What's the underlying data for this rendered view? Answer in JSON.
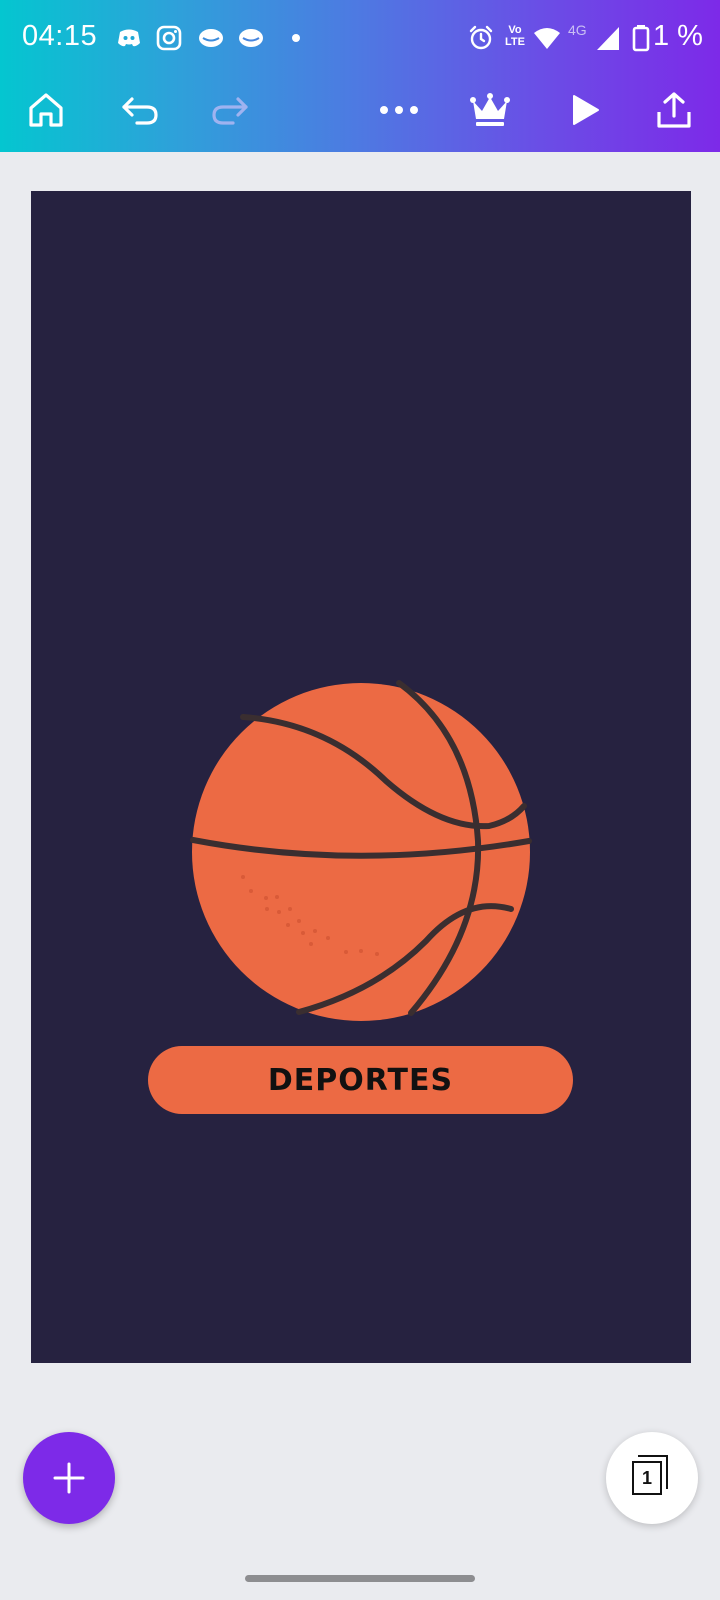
{
  "status_bar": {
    "time": "04:15",
    "network": "4G",
    "volte": "Vo LTE",
    "battery_percent": "1 %",
    "icons": [
      "discord-icon",
      "instagram-icon",
      "messenger-icon",
      "messenger-icon",
      "dot-icon",
      "alarm-icon",
      "volte-icon",
      "wifi-icon",
      "signal-icon",
      "battery-icon"
    ]
  },
  "toolbar": {
    "buttons": [
      "home-icon",
      "undo-icon",
      "redo-icon",
      "more-icon",
      "crown-icon",
      "play-icon",
      "share-icon"
    ]
  },
  "design": {
    "label": "DEPORTES",
    "background_color": "#262240",
    "accent_color": "#ec6a44"
  },
  "page_indicator": {
    "page": "1"
  },
  "fab": {
    "icon": "plus-icon"
  }
}
